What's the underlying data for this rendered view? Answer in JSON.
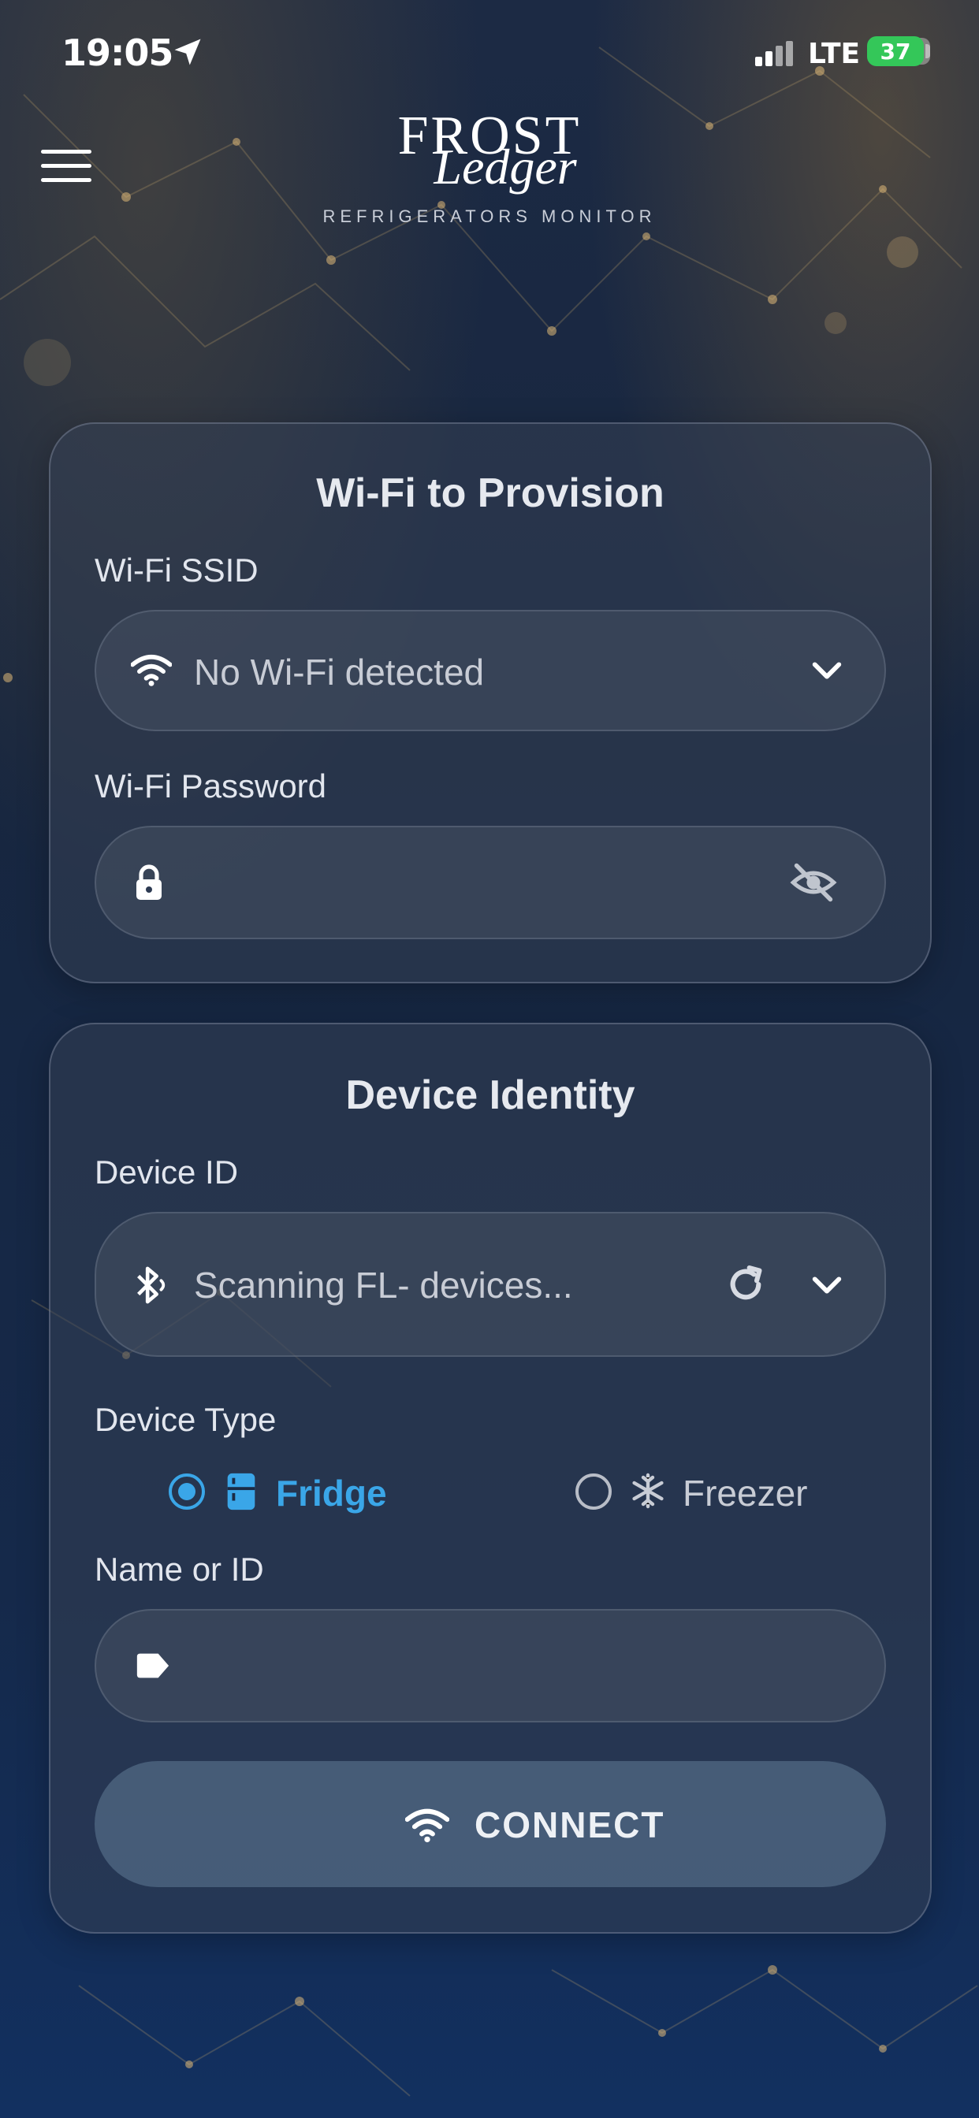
{
  "status_bar": {
    "time": "19:05",
    "network": "LTE",
    "battery": "37"
  },
  "header": {
    "logo_line1": "FROST",
    "logo_line2": "Ledger",
    "logo_subtitle": "REFRIGERATORS MONITOR"
  },
  "wifi_card": {
    "title": "Wi-Fi to Provision",
    "ssid_label": "Wi-Fi SSID",
    "ssid_value": "No Wi-Fi detected",
    "password_label": "Wi-Fi Password",
    "password_value": ""
  },
  "device_card": {
    "title": "Device Identity",
    "device_id_label": "Device ID",
    "device_id_value": "Scanning FL- devices...",
    "device_type_label": "Device Type",
    "type_options": [
      {
        "label": "Fridge",
        "selected": true
      },
      {
        "label": "Freezer",
        "selected": false
      }
    ],
    "name_label": "Name or ID",
    "name_value": "",
    "connect_label": "CONNECT"
  },
  "colors": {
    "accent": "#3aa6e8",
    "background": "#13223c",
    "battery": "#34c759"
  },
  "icons": [
    "menu-icon",
    "location-arrow-icon",
    "signal-icon",
    "battery-icon",
    "wifi-icon",
    "chevron-down-icon",
    "lock-icon",
    "eye-off-icon",
    "bluetooth-icon",
    "refresh-icon",
    "fridge-icon",
    "snowflake-icon",
    "tag-icon"
  ]
}
